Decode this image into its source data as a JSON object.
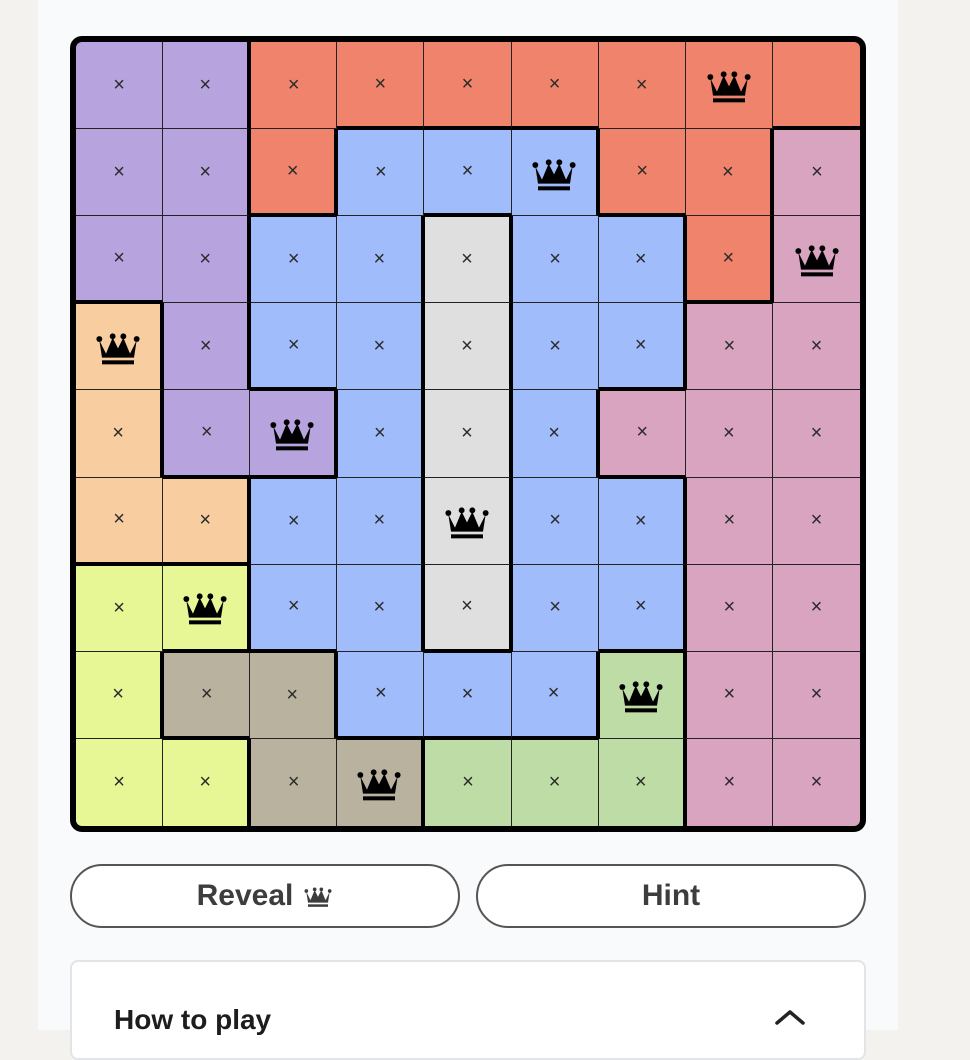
{
  "game": {
    "size": 9,
    "empty_mark": "×",
    "colors": {
      "P": "#b7a4de",
      "O": "#ef836b",
      "B": "#a0bcfa",
      "G": "#dfdfdf",
      "K": "#d8a4c0",
      "A": "#f8cd9f",
      "Y": "#e7f796",
      "T": "#b9b29e",
      "L": "#bddca6"
    },
    "regions": [
      "PPOOOOOOO",
      "PPOBBBOOK",
      "PPBBGBBOK",
      "APBBGBBKK",
      "APPBGBKKK",
      "AABBGBBKK",
      "YYBBGBBKK",
      "YTTBBBLKK",
      "YYTTLLLKK"
    ],
    "cells": [
      "xxxxxxxQ.",
      "xxxxxQxxx",
      "xxxxxxxxQ",
      "Qxxxxxxxx",
      "xxQxxxxxx",
      "xxxxQxxxx",
      "xQxxxxxxx",
      "xxxxxxQxx",
      "xxxQxxxxx"
    ]
  },
  "controls": {
    "reveal_label": "Reveal",
    "hint_label": "Hint"
  },
  "howto": {
    "title": "How to play"
  }
}
